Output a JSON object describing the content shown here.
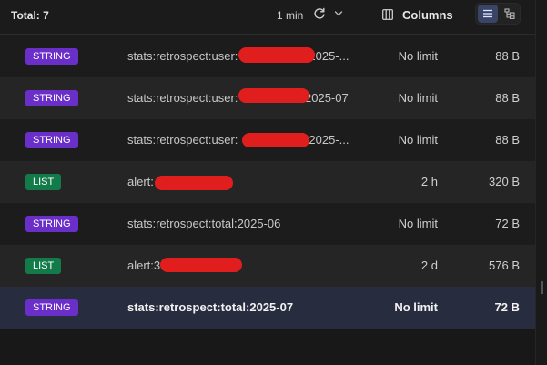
{
  "toolbar": {
    "total_label": "Total: 7",
    "refresh_interval": "1 min",
    "refresh_icon": "refresh-icon",
    "chevron_icon": "chevron-down-icon",
    "columns_label": "Columns",
    "columns_icon": "columns-icon",
    "view_list_icon": "list-view-icon",
    "view_tree_icon": "tree-view-icon"
  },
  "colors": {
    "string_badge": "#6a2fc8",
    "list_badge": "#137a4a",
    "selected_row": "#272c3f",
    "redaction": "#e01e1e"
  },
  "rows": [
    {
      "type": "STRING",
      "key": "stats:retrospect:user:",
      "key_suffix": "2025-...",
      "ttl": "No limit",
      "size": "88 B"
    },
    {
      "type": "STRING",
      "key": "stats:retrospect:user:",
      "key_suffix": ":2025-07",
      "ttl": "No limit",
      "size": "88 B"
    },
    {
      "type": "STRING",
      "key": "stats:retrospect:user:",
      "key_suffix": "2025-...",
      "ttl": "No limit",
      "size": "88 B"
    },
    {
      "type": "LIST",
      "key": "alert:",
      "key_suffix": "",
      "ttl": "2 h",
      "size": "320 B"
    },
    {
      "type": "STRING",
      "key": "stats:retrospect:total:2025-06",
      "key_suffix": "",
      "ttl": "No limit",
      "size": "72 B"
    },
    {
      "type": "LIST",
      "key": "alert:3",
      "key_suffix": "",
      "ttl": "2 d",
      "size": "576 B"
    },
    {
      "type": "STRING",
      "key": "stats:retrospect:total:2025-07",
      "key_suffix": "",
      "ttl": "No limit",
      "size": "72 B"
    }
  ]
}
